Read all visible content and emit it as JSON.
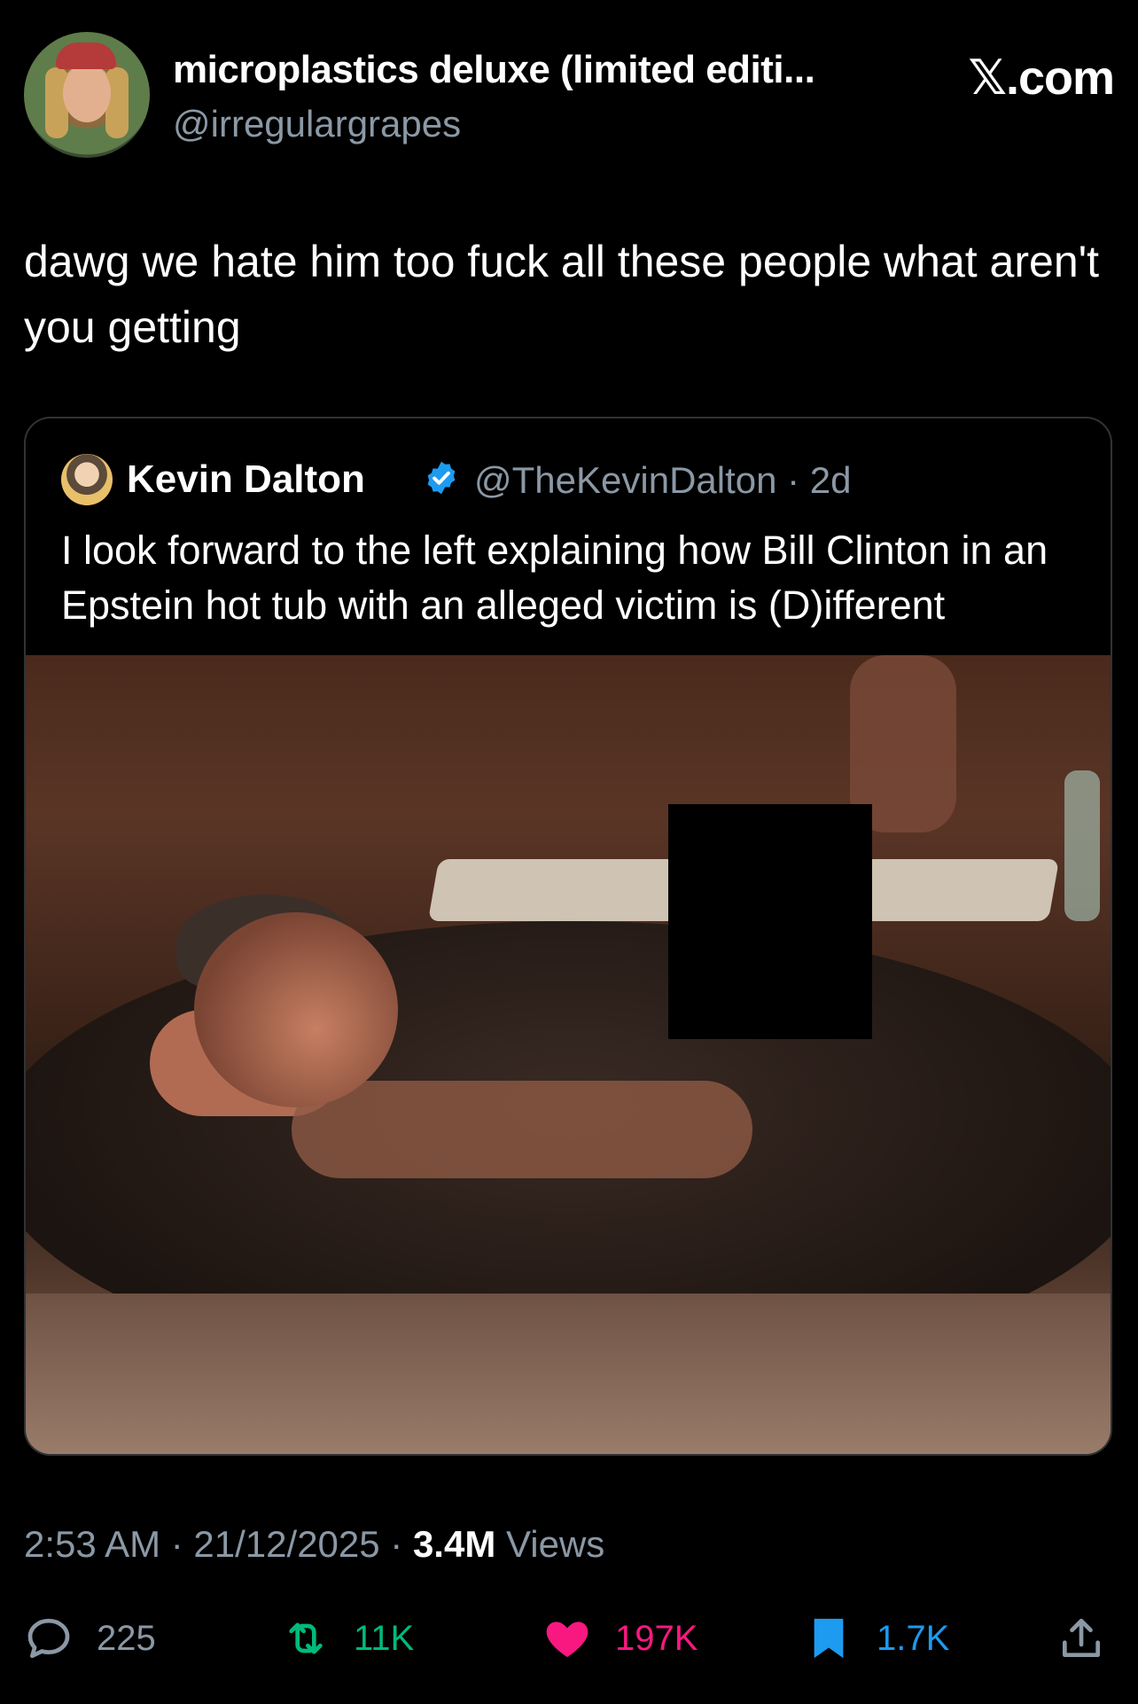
{
  "header": {
    "display_name": "microplastics deluxe (limited editi...",
    "handle": "@irregulargrapes",
    "brand_x": "𝕏",
    "brand_suffix": ".com"
  },
  "tweet": {
    "text": "dawg we hate him too fuck all these people what aren't you getting"
  },
  "quoted_tweet": {
    "author_name": "Kevin Dalton",
    "handle_time": "@TheKevinDalton · 2d",
    "text": "I look forward to the left explaining how Bill Clinton in an Epstein hot tub with an alleged victim is (D)ifferent"
  },
  "meta": {
    "time_date": "2:53 AM · 21/12/2025 · ",
    "views_count": "3.4M",
    "views_label": " Views"
  },
  "actions": {
    "replies": "225",
    "reposts": "11K",
    "likes": "197K",
    "bookmarks": "1.7K"
  },
  "colors": {
    "repost": "#00ba7c",
    "like": "#f91880",
    "bookmark": "#1d9bf0",
    "verified": "#1d9bf0",
    "muted": "#8b98a5"
  },
  "icons": {
    "reply": "reply-icon",
    "repost": "repost-icon",
    "like": "heart-icon",
    "bookmark": "bookmark-icon",
    "share": "share-icon"
  }
}
